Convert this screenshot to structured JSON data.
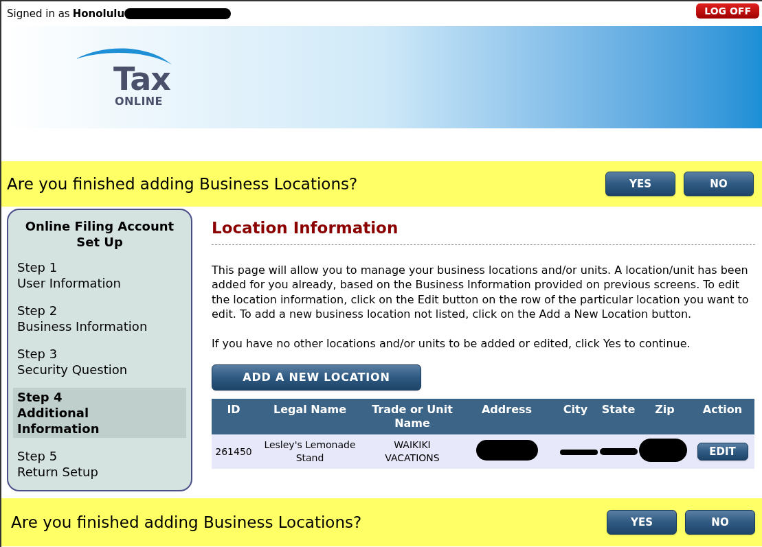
{
  "header": {
    "signed_in_label": "Signed in as",
    "user_name": "Honolulu",
    "user_redacted": true,
    "log_off": "LOG OFF"
  },
  "logo": {
    "word": "Tax",
    "sub": "ONLINE"
  },
  "question_bar_top": {
    "question": "Are you finished adding Business Locations?",
    "buttons": [
      "YES",
      "NO"
    ]
  },
  "sidebar": {
    "title": "Online Filing Account Set Up",
    "steps": [
      {
        "step": "Step 1",
        "label": "User Information",
        "selected": false
      },
      {
        "step": "Step 2",
        "label": "Business Information",
        "selected": false
      },
      {
        "step": "Step 3",
        "label": "Security Question",
        "selected": false
      },
      {
        "step": "Step 4",
        "label": "Additional Information",
        "selected": true
      },
      {
        "step": "Step 5",
        "label": "Return Setup",
        "selected": false
      }
    ]
  },
  "content": {
    "heading": "Location Information",
    "paragraphs": [
      "This page will allow you to manage your business locations and/or units. A location/unit has been added for you already, based on the Business Information provided on previous screens. To edit the location information, click on the Edit button on the row of the particular location you want to edit. To add a new business location not listed, click on the Add a New Location button.",
      "If you have no other locations and/or units to be added or edited, click Yes to continue."
    ],
    "add_button": "ADD A NEW LOCATION"
  },
  "table": {
    "columns": [
      "ID",
      "Legal Name",
      "Trade or Unit Name",
      "Address",
      "City",
      "State",
      "Zip",
      "Action"
    ],
    "rows": [
      {
        "id": "261450",
        "legal_name": "Lesley's Lemonade Stand",
        "trade_name": "WAIKIKI VACATIONS",
        "address_redacted": true,
        "city_state_zip_redacted": true,
        "action": "EDIT"
      }
    ]
  },
  "question_bar_bottom": {
    "question": "Are you finished adding Business Locations?",
    "buttons": [
      "YES",
      "NO"
    ]
  }
}
